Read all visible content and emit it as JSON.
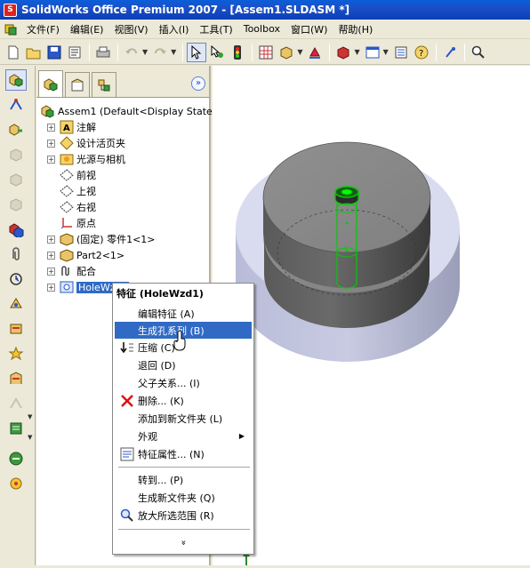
{
  "window": {
    "title": "SolidWorks Office Premium 2007 - [Assem1.SLDASM *]"
  },
  "menubar": {
    "items": [
      "文件(F)",
      "编辑(E)",
      "视图(V)",
      "插入(I)",
      "工具(T)",
      "Toolbox",
      "窗口(W)",
      "帮助(H)"
    ]
  },
  "toolbar": {
    "icons": [
      "new-icon",
      "open-icon",
      "save-icon",
      "properties-icon",
      "print-icon",
      "undo-icon",
      "redo-icon",
      "select-icon",
      "select-other-icon",
      "traffic-light-icon",
      "grid-icon",
      "box-icon",
      "rotate-icon",
      "display-icon",
      "window-icon",
      "list-icon",
      "help-icon",
      "pin-icon",
      "zoom-icon"
    ]
  },
  "feature_tree": {
    "root": "Assem1  (Default<Display State-1",
    "items": [
      {
        "label": "注解",
        "icon": "annotation-icon"
      },
      {
        "label": "设计活页夹",
        "icon": "design-binder-icon"
      },
      {
        "label": "光源与相机",
        "icon": "lights-cameras-icon"
      },
      {
        "label": "前视",
        "icon": "plane-icon"
      },
      {
        "label": "上视",
        "icon": "plane-icon"
      },
      {
        "label": "右视",
        "icon": "plane-icon"
      },
      {
        "label": "原点",
        "icon": "origin-icon"
      },
      {
        "label": "(固定) 零件1<1>",
        "icon": "part-icon"
      },
      {
        "label": "Part2<1>",
        "icon": "part-icon"
      },
      {
        "label": "配合",
        "icon": "mates-icon"
      },
      {
        "label": "HoleWzd1",
        "icon": "hole-wizard-icon"
      }
    ]
  },
  "context_menu": {
    "title": "特征 (HoleWzd1)",
    "items": [
      {
        "label": "编辑特征 (A)",
        "icon": ""
      },
      {
        "label": "生成孔系列 (B)",
        "icon": ""
      },
      {
        "label": "压缩 (C)",
        "icon": "suppress-icon"
      },
      {
        "label": "退回 (D)",
        "icon": ""
      },
      {
        "label": "父子关系... (I)",
        "icon": ""
      },
      {
        "label": "删除... (K)",
        "icon": "delete-icon"
      },
      {
        "label": "添加到新文件夹 (L)",
        "icon": ""
      },
      {
        "label": "外观",
        "icon": ""
      },
      {
        "label": "特征属性... (N)",
        "icon": "properties-icon"
      },
      {
        "label": "转到... (P)",
        "icon": ""
      },
      {
        "label": "生成新文件夹 (Q)",
        "icon": ""
      },
      {
        "label": "放大所选范围 (R)",
        "icon": "zoom-to-selection-icon"
      }
    ],
    "highlighted_index": 1,
    "more": "»"
  },
  "colors": {
    "highlight": "#316ac5",
    "titlebar": "#0a5fd8",
    "hole_outline": "#00cc00"
  }
}
